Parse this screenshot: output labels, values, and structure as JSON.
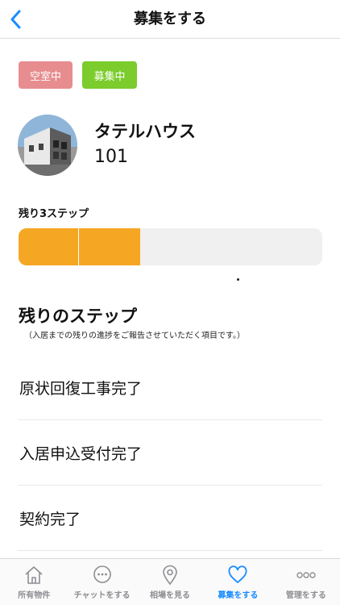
{
  "nav": {
    "title": "募集をする"
  },
  "status": {
    "vacant_label": "空室中",
    "recruiting_label": "募集中"
  },
  "property": {
    "name": "タテルハウス",
    "room": "101"
  },
  "progress": {
    "label": "残り3ステップ",
    "total_steps": 5,
    "completed_steps": 2
  },
  "remaining": {
    "title": "残りのステップ",
    "note": "（入居までの残りの進捗をご報告させていただく項目です。）",
    "steps": [
      {
        "label": "原状回復工事完了"
      },
      {
        "label": "入居申込受付完了"
      },
      {
        "label": "契約完了"
      }
    ]
  },
  "tabbar": {
    "items": [
      {
        "label": "所有物件",
        "icon": "home-icon"
      },
      {
        "label": "チャットをする",
        "icon": "chat-icon"
      },
      {
        "label": "相場を見る",
        "icon": "map-pin-icon"
      },
      {
        "label": "募集をする",
        "icon": "heart-icon"
      },
      {
        "label": "管理をする",
        "icon": "more-icon"
      }
    ],
    "active_index": 3
  },
  "colors": {
    "accent": "#1a8cff",
    "progress_fill": "#f5a623",
    "vacant": "#e78d8f",
    "recruiting": "#7bcc2c"
  }
}
